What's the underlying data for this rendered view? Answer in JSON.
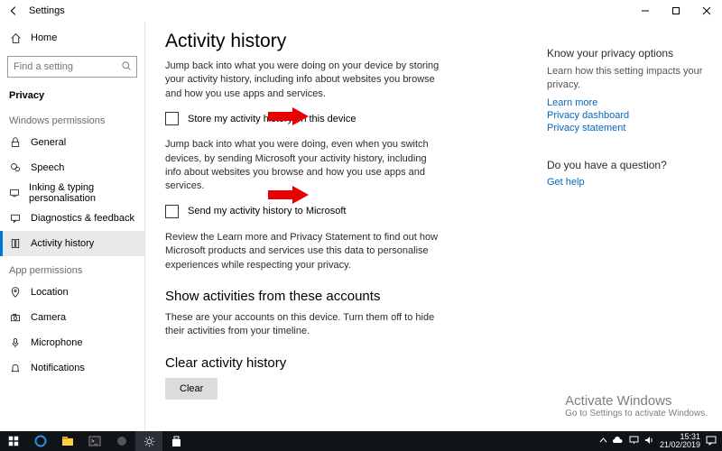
{
  "titlebar": {
    "title": "Settings"
  },
  "sidebar": {
    "home": "Home",
    "search_placeholder": "Find a setting",
    "current_section": "Privacy",
    "groups": [
      {
        "heading": "Windows permissions",
        "items": [
          {
            "label": "General"
          },
          {
            "label": "Speech"
          },
          {
            "label": "Inking & typing personalisation"
          },
          {
            "label": "Diagnostics & feedback"
          },
          {
            "label": "Activity history"
          }
        ]
      },
      {
        "heading": "App permissions",
        "items": [
          {
            "label": "Location"
          },
          {
            "label": "Camera"
          },
          {
            "label": "Microphone"
          },
          {
            "label": "Notifications"
          }
        ]
      }
    ]
  },
  "content": {
    "h1": "Activity history",
    "p1": "Jump back into what you were doing on your device by storing your activity history, including info about websites you browse and how you use apps and services.",
    "chk1": "Store my activity history on this device",
    "p2": "Jump back into what you were doing, even when you switch devices, by sending Microsoft your activity history, including info about websites you browse and how you use apps and services.",
    "chk2": "Send my activity history to Microsoft",
    "p3": "Review the Learn more and Privacy Statement to find out how Microsoft products and services use this data to personalise experiences while respecting your privacy.",
    "h2a": "Show activities from these accounts",
    "p4": "These are your accounts on this device. Turn them off to hide their activities from your timeline.",
    "h2b": "Clear activity history",
    "clear": "Clear"
  },
  "right": {
    "head1": "Know your privacy options",
    "body1": "Learn how this setting impacts your privacy.",
    "link1": "Learn more",
    "link2": "Privacy dashboard",
    "link3": "Privacy statement",
    "head2": "Do you have a question?",
    "link4": "Get help"
  },
  "watermark": {
    "l1": "Activate Windows",
    "l2": "Go to Settings to activate Windows."
  },
  "taskbar": {
    "time": "15:31",
    "date": "21/02/2019"
  }
}
